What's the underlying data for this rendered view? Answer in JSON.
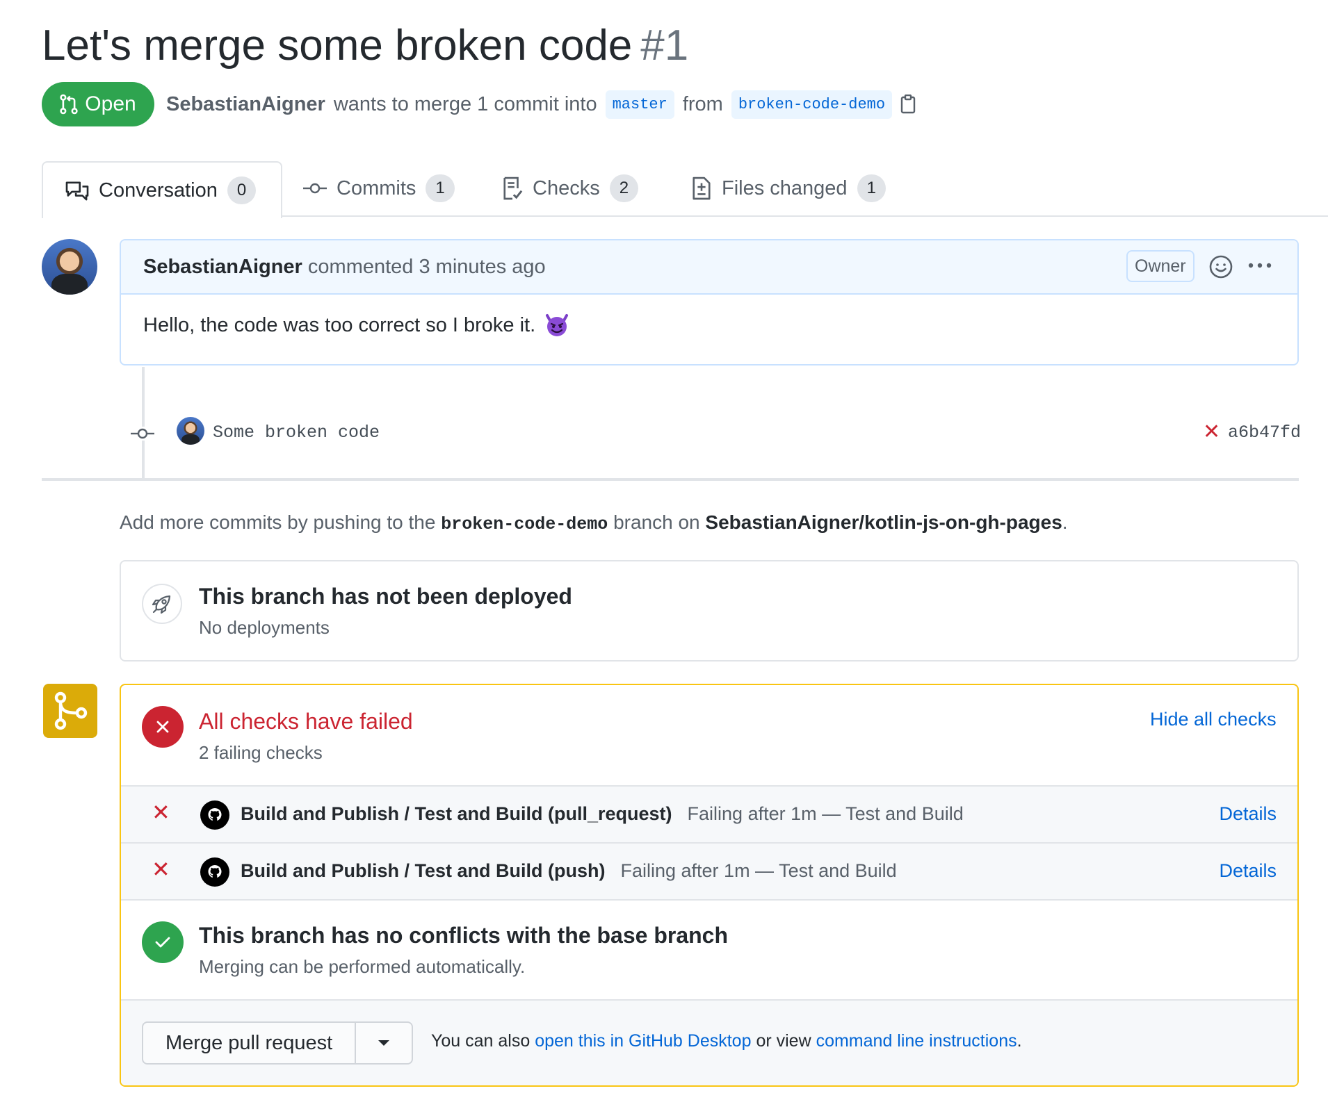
{
  "pr": {
    "title": "Let's merge some broken code",
    "number": "#1",
    "status": "Open",
    "author": "SebastianAigner",
    "merge_text": "wants to merge 1 commit into",
    "base_branch": "master",
    "from_text": "from",
    "head_branch": "broken-code-demo"
  },
  "tabs": [
    {
      "label": "Conversation",
      "count": "0"
    },
    {
      "label": "Commits",
      "count": "1"
    },
    {
      "label": "Checks",
      "count": "2"
    },
    {
      "label": "Files changed",
      "count": "1"
    }
  ],
  "comment": {
    "author": "SebastianAigner",
    "meta": "commented 3 minutes ago",
    "badge": "Owner",
    "body": "Hello, the code was too correct so I broke it."
  },
  "commit": {
    "message": "Some broken code",
    "sha": "a6b47fd"
  },
  "hint": {
    "prefix": "Add more commits by pushing to the",
    "branch": "broken-code-demo",
    "middle": "branch on",
    "repo": "SebastianAigner/kotlin-js-on-gh-pages",
    "suffix": "."
  },
  "deploy": {
    "title": "This branch has not been deployed",
    "subtitle": "No deployments"
  },
  "checks": {
    "title": "All checks have failed",
    "subtitle": "2 failing checks",
    "toggle": "Hide all checks",
    "items": [
      {
        "name": "Build and Publish / Test and Build (pull_request)",
        "status": "Failing after 1m — Test and Build",
        "action": "Details"
      },
      {
        "name": "Build and Publish / Test and Build (push)",
        "status": "Failing after 1m — Test and Build",
        "action": "Details"
      }
    ]
  },
  "conflicts": {
    "title": "This branch has no conflicts with the base branch",
    "subtitle": "Merging can be performed automatically."
  },
  "merge": {
    "button": "Merge pull request",
    "text1": "You can also",
    "link1": "open this in GitHub Desktop",
    "text2": "or view",
    "link2": "command line instructions",
    "text3": "."
  },
  "colors": {
    "open_green": "#2ea44f",
    "fail_red": "#cb2431",
    "link_blue": "#0366d6",
    "pending_yellow": "#dbab09"
  }
}
